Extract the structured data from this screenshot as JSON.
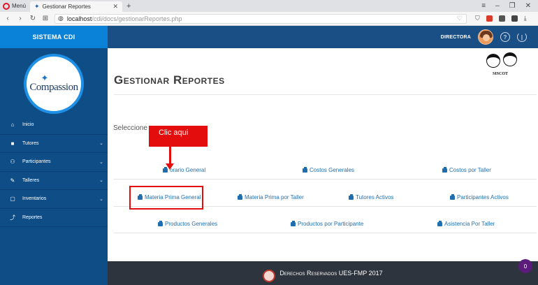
{
  "browser": {
    "menu_label": "Menú",
    "tab_title": "Gestionar Reportes",
    "url_host": "localhost",
    "url_path": "/cdi/docs/gestionarReportes.php"
  },
  "app": {
    "sidebar_title": "SISTEMA CDI",
    "user_role": "DIRECTORA",
    "help_symbol": "?",
    "logo_text": "Compassion",
    "logo_brand_label": "SISCOT"
  },
  "sidebar": {
    "items": [
      {
        "label": "Inicio",
        "icon": "home-icon",
        "glyph": "⌂",
        "expandable": false
      },
      {
        "label": "Tutores",
        "icon": "briefcase-icon",
        "glyph": "■",
        "expandable": true
      },
      {
        "label": "Participantes",
        "icon": "people-icon",
        "glyph": "👥",
        "expandable": true
      },
      {
        "label": "Talleres",
        "icon": "wrench-icon",
        "glyph": "🔧",
        "expandable": true
      },
      {
        "label": "Inventarios",
        "icon": "clipboard-icon",
        "glyph": "▢",
        "expandable": true
      },
      {
        "label": "Reportes",
        "icon": "chart-line-icon",
        "glyph": "⤴",
        "expandable": false
      }
    ]
  },
  "main": {
    "title": "Gestionar Reportes",
    "select_prompt": "Seleccione un",
    "annotation_label": "Clic aqui",
    "rows": [
      [
        "orario General",
        "Costos Generales",
        "Costos por Taller"
      ],
      [
        "Materia Prima General",
        "Materia Prima por Taller",
        "Tutores Activos",
        "Participantes Activos"
      ],
      [
        "Productos Generales",
        "Productos por Participante",
        "Asistencia Por Taller"
      ]
    ]
  },
  "footer": {
    "text": "Derechos Reservados UES-FMP 2017"
  },
  "badge": {
    "count": "0"
  },
  "colors": {
    "sidebar_head": "#0a82d8",
    "sidebar": "#0f4d86",
    "topbar": "#1a4f86",
    "link": "#1f6fb0",
    "annotation": "#e30d0d",
    "footer": "#2d343d"
  }
}
